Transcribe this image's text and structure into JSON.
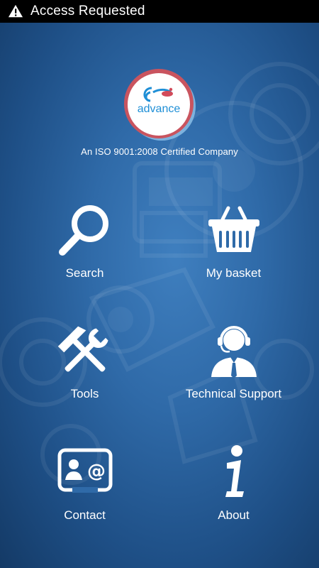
{
  "status_bar": {
    "title": "Access Requested",
    "icon": "warning-icon"
  },
  "brand": {
    "logo_text": "advance",
    "tagline": "An ISO 9001:2008 Certified Company",
    "logo_ring_color": "#c9545f",
    "logo_text_color": "#1f8fd6"
  },
  "menu": {
    "items": [
      {
        "label": "Search",
        "icon": "search-icon"
      },
      {
        "label": "My basket",
        "icon": "basket-icon"
      },
      {
        "label": "Tools",
        "icon": "tools-icon"
      },
      {
        "label": "Technical Support",
        "icon": "headset-support-icon"
      },
      {
        "label": "Contact",
        "icon": "contact-card-icon"
      },
      {
        "label": "About",
        "icon": "info-icon"
      }
    ]
  },
  "colors": {
    "background_center": "#3f7fbf",
    "background_edge": "#143a66",
    "status_bar": "#000000",
    "text": "#ffffff"
  }
}
